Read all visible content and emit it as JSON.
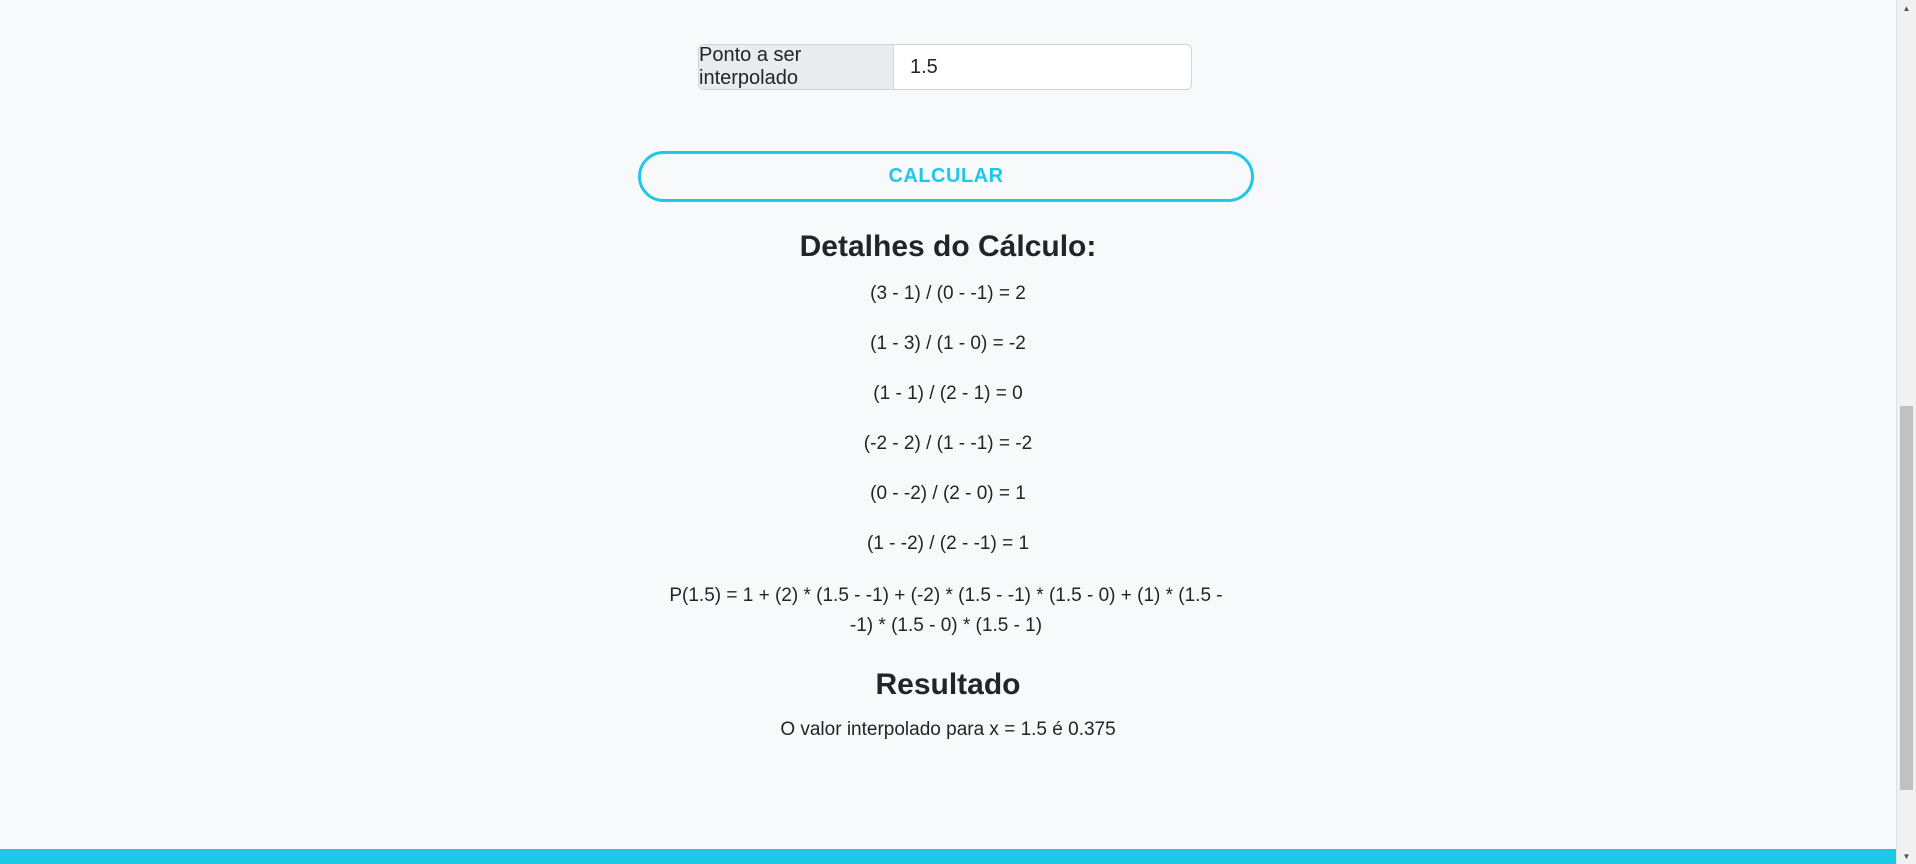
{
  "interpolation_point": {
    "label": "Ponto a ser interpolado",
    "value": "1.5"
  },
  "calculate_button": {
    "label": "CALCULAR"
  },
  "details": {
    "title": "Detalhes do Cálculo:",
    "steps": [
      "(3 - 1) / (0 - -1) = 2",
      "(1 - 3) / (1 - 0) = -2",
      "(1 - 1) / (2 - 1) = 0",
      "(-2 - 2) / (1 - -1) = -2",
      "(0 - -2) / (2 - 0) = 1",
      "(1 - -2) / (2 - -1) = 1"
    ],
    "polynomial": "P(1.5) = 1 + (2) * (1.5 - -1) + (-2) * (1.5 - -1) * (1.5 - 0) + (1) * (1.5 - -1) * (1.5 - 0) * (1.5 - 1)"
  },
  "result": {
    "title": "Resultado",
    "text": "O valor interpolado para x = 1.5 é 0.375"
  },
  "colors": {
    "accent": "#1ec8e6",
    "background": "#f8f9fa",
    "text": "#212529"
  },
  "scrollbar": {
    "up_icon": "triangle-up-icon",
    "down_icon": "triangle-down-icon"
  }
}
